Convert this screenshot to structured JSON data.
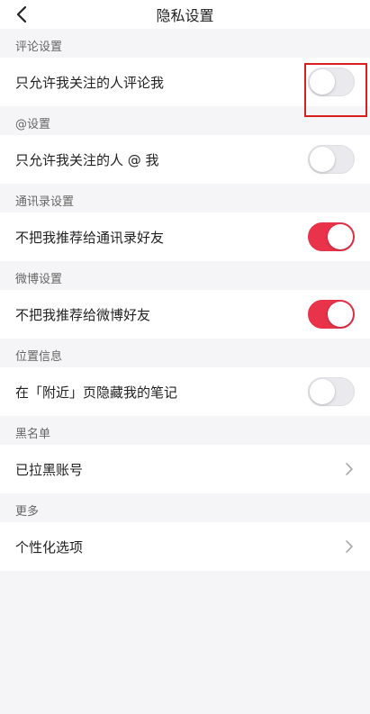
{
  "header": {
    "title": "隐私设置"
  },
  "sections": [
    {
      "header": "评论设置",
      "item": {
        "label": "只允许我关注的人评论我",
        "toggle_on": false
      }
    },
    {
      "header": "@设置",
      "item": {
        "label": "只允许我关注的人 @ 我",
        "toggle_on": false
      }
    },
    {
      "header": "通讯录设置",
      "item": {
        "label": "不把我推荐给通讯录好友",
        "toggle_on": true
      }
    },
    {
      "header": "微博设置",
      "item": {
        "label": "不把我推荐给微博好友",
        "toggle_on": true
      }
    },
    {
      "header": "位置信息",
      "item": {
        "label": "在「附近」页隐藏我的笔记",
        "toggle_on": false
      }
    },
    {
      "header": "黑名单",
      "item": {
        "label": "已拉黑账号"
      }
    },
    {
      "header": "更多",
      "item": {
        "label": "个性化选项"
      }
    }
  ],
  "colors": {
    "toggle_on": "#e8334a",
    "highlight_box": "#d81e1e"
  },
  "icons": {
    "back": "back-arrow-icon",
    "chevron": "chevron-right-icon"
  }
}
